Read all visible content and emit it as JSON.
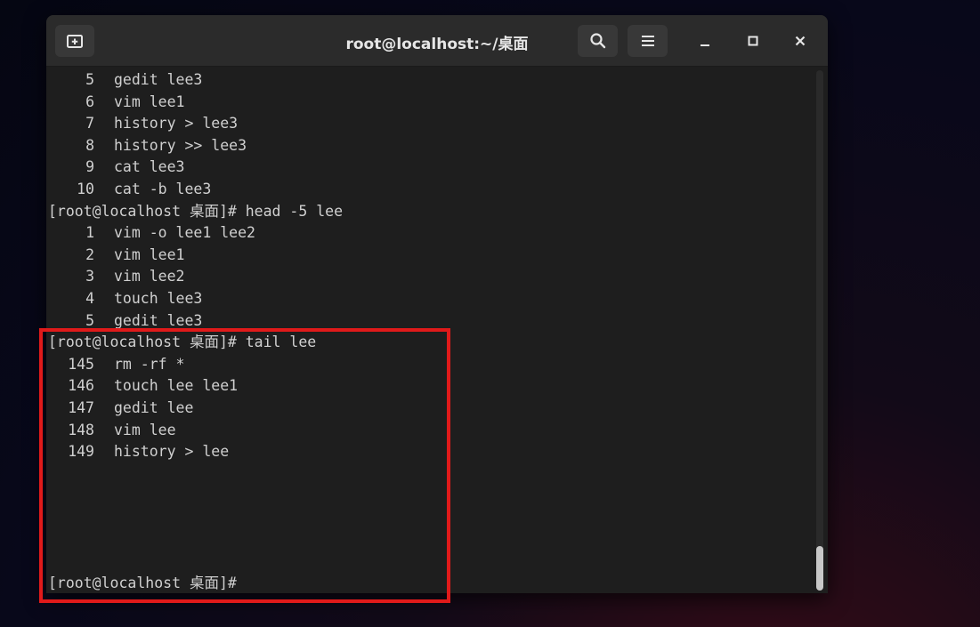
{
  "window": {
    "title": "root@localhost:~/桌面"
  },
  "titlebar": {
    "new_tab_icon": "new-tab-icon",
    "search_icon": "search-icon",
    "menu_icon": "hamburger-menu-icon",
    "minimize_icon": "minimize-icon",
    "maximize_icon": "maximize-icon",
    "close_icon": "close-icon"
  },
  "terminal": {
    "history_top": [
      {
        "num": "5",
        "cmd": "gedit lee3"
      },
      {
        "num": "6",
        "cmd": "vim lee1"
      },
      {
        "num": "7",
        "cmd": "history > lee3"
      },
      {
        "num": "8",
        "cmd": "history >> lee3"
      },
      {
        "num": "9",
        "cmd": "cat lee3"
      },
      {
        "num": "10",
        "cmd": "cat -b lee3"
      }
    ],
    "prompt_head": "[root@localhost 桌面]# head -5 lee",
    "head_output": [
      {
        "num": "1",
        "cmd": "vim -o lee1 lee2"
      },
      {
        "num": "2",
        "cmd": "vim lee1"
      },
      {
        "num": "3",
        "cmd": "vim lee2"
      },
      {
        "num": "4",
        "cmd": "touch lee3"
      },
      {
        "num": "5",
        "cmd": "gedit lee3"
      }
    ],
    "prompt_tail": "[root@localhost 桌面]# tail lee",
    "tail_output": [
      {
        "num": "145",
        "cmd": "rm -rf *"
      },
      {
        "num": "146",
        "cmd": "touch lee lee1"
      },
      {
        "num": "147",
        "cmd": "gedit lee"
      },
      {
        "num": "148",
        "cmd": "vim lee"
      },
      {
        "num": "149",
        "cmd": "history > lee"
      }
    ],
    "prompt_final": "[root@localhost 桌面]#"
  },
  "colors": {
    "annotation_box": "#e01a1a",
    "terminal_bg": "#1e1e1e",
    "terminal_fg": "#d0d0d0"
  }
}
